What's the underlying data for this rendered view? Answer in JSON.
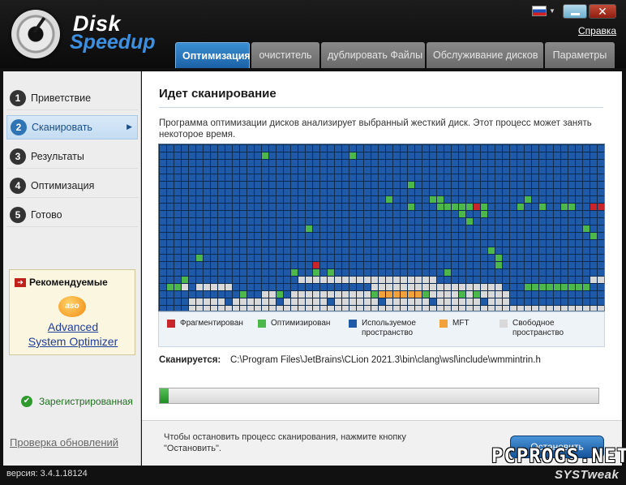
{
  "app": {
    "logo_line1": "Disk",
    "logo_line2": "Speedup",
    "help_label": "Справка",
    "close_glyph": "✕",
    "version": "версия: 3.4.1.18124",
    "brand": "SYSTweak",
    "watermark": "PCPROGS.NET"
  },
  "tabs": [
    {
      "label": "Оптимизация",
      "active": true
    },
    {
      "label": "очиститель",
      "active": false
    },
    {
      "label": "дублировать Файлы",
      "active": false
    },
    {
      "label": "Обслуживание дисков",
      "active": false
    },
    {
      "label": "Параметры",
      "active": false
    }
  ],
  "steps": [
    {
      "num": "1",
      "label": "Приветствие"
    },
    {
      "num": "2",
      "label": "Сканировать",
      "active": true
    },
    {
      "num": "3",
      "label": "Результаты"
    },
    {
      "num": "4",
      "label": "Оптимизация"
    },
    {
      "num": "5",
      "label": "Готово"
    }
  ],
  "recommend": {
    "title": "Рекомендуемые",
    "logo_text": "aso",
    "product_line1": "Advanced",
    "product_line2": "System Optimizer"
  },
  "sidebar": {
    "registered": "Зарегистрированная",
    "check_updates": "Проверка обновлений"
  },
  "main": {
    "title": "Идет сканирование",
    "description": "Программа оптимизации дисков анализирует выбранный жесткий диск. Этот процесс может занять некоторое время.",
    "scanning_label": "Сканируется:",
    "scanning_path": "C:\\Program Files\\JetBrains\\CLion 2021.3\\bin\\clang\\wsl\\include\\wmmintrin.h",
    "progress": 0.02
  },
  "legend": [
    {
      "label": "Фрагментирован",
      "color": "#c8262a"
    },
    {
      "label": "Оптимизирован",
      "color": "#4cb84c"
    },
    {
      "label": "Используемое пространство",
      "color": "#1e5aa8"
    },
    {
      "label": "MFT",
      "color": "#f2a23a"
    },
    {
      "label": "Свободное пространство",
      "color": "#d9d9d9"
    }
  ],
  "footer": {
    "note": "Чтобы остановить процесс сканирования, нажмите кнопку \"Остановить\".",
    "stop_label": "Остановить"
  },
  "colors": {
    "used": "#1e5aa8",
    "optimized": "#4cb84c",
    "fragmented": "#c8262a",
    "mft": "#f2a23a",
    "free": "#d9d9d9",
    "accent": "#1f6fb8"
  }
}
